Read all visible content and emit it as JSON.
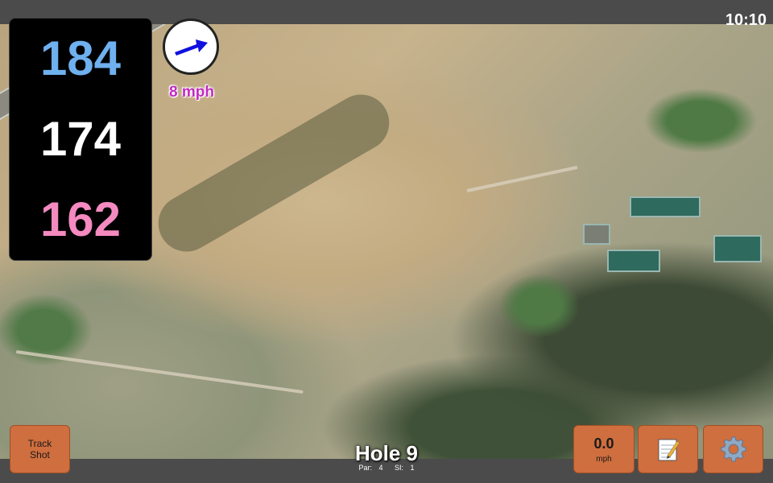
{
  "status": {
    "time": "10:10"
  },
  "yardages": {
    "back": "184",
    "middle": "174",
    "front": "162"
  },
  "wind": {
    "speed_label": "8 mph",
    "direction_icon": "arrow-right-up-icon",
    "arrow_color": "#1010e0"
  },
  "hole": {
    "title": "Hole 9",
    "par_label": "Par: 4",
    "si_label": "SI: 1"
  },
  "buttons": {
    "track_shot_line1": "Track",
    "track_shot_line2": "Shot",
    "speed_value": "0.0",
    "speed_unit": "mph",
    "notes_icon": "notepad-icon",
    "settings_icon": "gear-icon"
  },
  "colors": {
    "back_yardage": "#6fb0ef",
    "middle_yardage": "#ffffff",
    "front_yardage": "#f48ac0",
    "button_bg": "#cf6e3e",
    "wind_text": "#c22ac2"
  }
}
